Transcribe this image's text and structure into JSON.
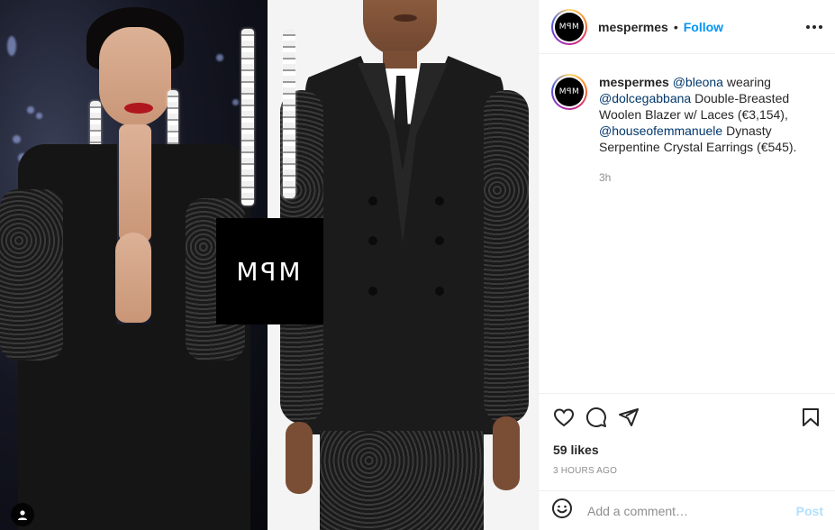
{
  "media": {
    "logo_text": "MꟼM",
    "left_photo_desc_icon": "person-tag-icon"
  },
  "header": {
    "avatar_text": "MꟼM",
    "username": "mespermes",
    "separator": "•",
    "follow_label": "Follow",
    "more_icon": "more-horizontal-icon"
  },
  "caption": {
    "avatar_text": "MꟼM",
    "username": "mespermes",
    "parts": [
      {
        "type": "mention",
        "text": "@bleona"
      },
      {
        "type": "text",
        "text": " wearing "
      },
      {
        "type": "mention",
        "text": "@dolcegabbana"
      },
      {
        "type": "text",
        "text": " Double-Breasted Woolen Blazer w/ Laces (€3,154), "
      },
      {
        "type": "mention",
        "text": "@houseofemmanuele"
      },
      {
        "type": "text",
        "text": " Dynasty Serpentine Crystal Earrings (€545)."
      }
    ],
    "time": "3h"
  },
  "actions": {
    "like_icon": "heart-icon",
    "comment_icon": "comment-icon",
    "share_icon": "paper-plane-icon",
    "save_icon": "bookmark-icon"
  },
  "likes": "59 likes",
  "posted": "3 HOURS AGO",
  "comment": {
    "emoji_icon": "smiley-icon",
    "placeholder": "Add a comment…",
    "value": "",
    "post_label": "Post"
  },
  "colors": {
    "accent": "#0095f6",
    "mention": "#00376b",
    "post_disabled": "#b2dffc"
  }
}
